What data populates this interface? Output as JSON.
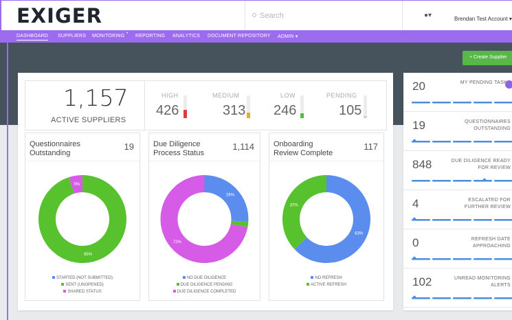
{
  "header": {
    "logo": "EXIGER",
    "search_placeholder": "Search",
    "eye_menu": "●▾",
    "user": "Brendan Test Account ▾"
  },
  "nav": {
    "items": [
      {
        "label": "DASHBOARD",
        "active": true
      },
      {
        "label": "SUPPLIERS"
      },
      {
        "label": "MONITORING"
      },
      {
        "label": "REPORTING"
      },
      {
        "label": "ANALYTICS"
      },
      {
        "label": "DOCUMENT REPOSITORY"
      },
      {
        "label": "ADMIN ▾"
      }
    ],
    "monitoring_badge": "•"
  },
  "create_button": "+ Create Supplier",
  "summary": {
    "total": "1,157",
    "total_label": "ACTIVE SUPPLIERS",
    "stats": [
      {
        "label": "HIGH",
        "value": "426",
        "color": "#e0393e",
        "fill": 0.35
      },
      {
        "label": "MEDIUM",
        "value": "313",
        "color": "#f5a623",
        "fill": 0.25
      },
      {
        "label": "LOW",
        "value": "246",
        "color": "#57b847",
        "fill": 0.2
      },
      {
        "label": "PENDING",
        "value": "105",
        "color": "#cfcfcf",
        "fill": 0.1
      }
    ]
  },
  "cards": [
    {
      "title": "Questionnaires\nOutstanding",
      "count": "19",
      "slices": [
        {
          "label": "STARTED (NOT SUBMITTED)",
          "value": 0,
          "color": "#5b8def",
          "pct": ""
        },
        {
          "label": "SENT (UNOPENED)",
          "value": 95,
          "color": "#57c22e",
          "pct": "95%"
        },
        {
          "label": "SHARED STATUS",
          "value": 5,
          "color": "#d65ce8",
          "pct": "5%"
        }
      ]
    },
    {
      "title": "Due Diligence\nProcess Status",
      "count": "1,114",
      "slices": [
        {
          "label": "NO DUE DILIGENCE",
          "value": 26,
          "color": "#5b8def",
          "pct": "26%"
        },
        {
          "label": "DUE DILIGENCE PENDING",
          "value": 2,
          "color": "#57c22e",
          "pct": ""
        },
        {
          "label": "DUE DILIGENCE COMPLETED",
          "value": 72,
          "color": "#d65ce8",
          "pct": "72%"
        }
      ]
    },
    {
      "title": "Onboarding\nReview Complete",
      "count": "117",
      "slices": [
        {
          "label": "NO REFRESH",
          "value": 63,
          "color": "#5b8def",
          "pct": "63%"
        },
        {
          "label": "ACTIVE REFRESH",
          "value": 37,
          "color": "#57c22e",
          "pct": "37%"
        }
      ]
    }
  ],
  "side_metrics": [
    {
      "value": "20",
      "label": "MY PENDING TASKS"
    },
    {
      "value": "19",
      "label": "QUESTIONNAIRES\nOUTSTANDING"
    },
    {
      "value": "848",
      "label": "DUE DILIGENCE READY\nFOR REVIEW"
    },
    {
      "value": "4",
      "label": "ESCALATED FOR\nFURTHER REVIEW"
    },
    {
      "value": "0",
      "label": "REFRESH DATE\nAPPROACHING"
    },
    {
      "value": "102",
      "label": "UNREAD MONITORING\nALERTS"
    }
  ]
}
